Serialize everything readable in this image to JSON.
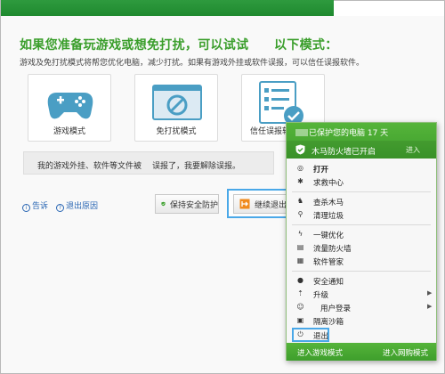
{
  "dialog": {
    "heading": "如果您准备玩游戏或想免打扰，可以试试　　以下模式：",
    "subtext": "游戏及免打扰模式将帮您优化电脑，减少打扰。如果有游戏外挂或软件误报，可以信任误报软件。",
    "modes": [
      {
        "label": "游戏模式",
        "icon": "gamepad-icon"
      },
      {
        "label": "免打扰模式",
        "icon": "no-disturb-icon"
      },
      {
        "label": "信任误报软",
        "icon": "checklist-icon"
      }
    ],
    "info_bar": {
      "left": "我的游戏外挂、软件等文件被",
      "right": "误报了，我要解除误报。"
    },
    "links": [
      {
        "label": "告诉",
        "icon": "info-icon"
      },
      {
        "label": "退出原因",
        "icon": "question-icon"
      }
    ],
    "buttons": {
      "keep_protect": "保持安全防护",
      "continue_exit": "继续退出"
    }
  },
  "tray_menu": {
    "header_line": "已保护您的电脑 17 天",
    "status_line": "木马防火墙已开启",
    "status_action": "进入",
    "items": [
      {
        "label": "打开",
        "icon": "open-icon",
        "bold": true
      },
      {
        "label": "求救中心",
        "icon": "help-center-icon"
      },
      {
        "label": "查杀木马",
        "icon": "trojan-scan-icon"
      },
      {
        "label": "清理垃圾",
        "icon": "broom-icon"
      },
      {
        "label": "一键优化",
        "icon": "bolt-icon"
      },
      {
        "label": "流量防火墙",
        "icon": "bandwidth-icon"
      },
      {
        "label": "软件管家",
        "icon": "grid-icon"
      },
      {
        "label": "安全通知",
        "icon": "bell-icon"
      },
      {
        "label": "升级",
        "icon": "upgrade-icon",
        "submenu": true
      },
      {
        "label": "用户登录",
        "icon": "user-icon",
        "submenu": true
      },
      {
        "label": "隔离沙箱",
        "icon": "sandbox-icon"
      },
      {
        "label": "退出",
        "icon": "power-icon"
      }
    ],
    "footer": {
      "left": "进入游戏模式",
      "right": "进入网购模式"
    }
  },
  "colors": {
    "brand_green": "#3a9e2b",
    "menu_green": "#4caa36",
    "link_blue": "#2a67b4",
    "highlight": "#4aa8e8"
  }
}
